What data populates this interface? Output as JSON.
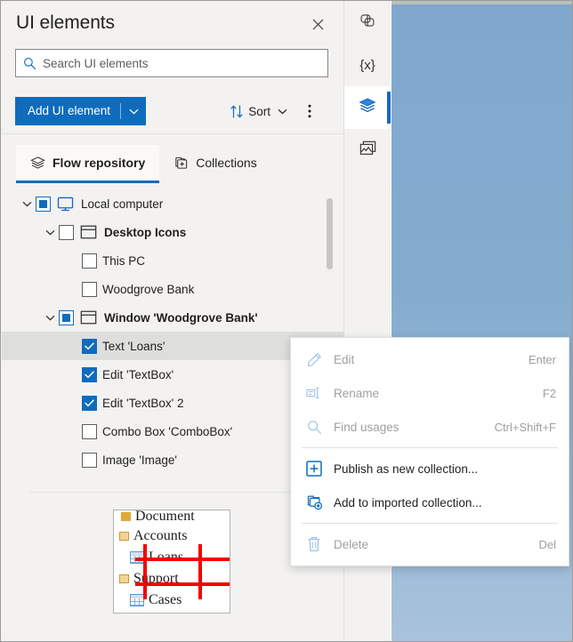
{
  "panel": {
    "title": "UI elements",
    "close_icon": "close-icon"
  },
  "search": {
    "placeholder": "Search UI elements",
    "value": "",
    "icon": "search-icon"
  },
  "toolbar": {
    "add_label": "Add UI element",
    "add_caret_icon": "chevron-down-icon",
    "sort_label": "Sort",
    "sort_icon": "sort-arrows-icon",
    "sort_caret_icon": "chevron-down-icon",
    "more_icon": "more-vertical-icon"
  },
  "tabs": [
    {
      "label": "Flow repository",
      "icon": "layers-icon",
      "active": true
    },
    {
      "label": "Collections",
      "icon": "collection-add-icon",
      "active": false
    }
  ],
  "tree": [
    {
      "label": "Local computer",
      "indent": 0,
      "chevron": "expanded",
      "checkbox": "partial",
      "icon": "monitor-icon",
      "bold": false,
      "selected": false
    },
    {
      "label": "Desktop Icons",
      "indent": 1,
      "chevron": "expanded",
      "checkbox": "unchecked",
      "icon": "window-icon",
      "bold": true,
      "selected": false
    },
    {
      "label": "This PC",
      "indent": 2,
      "chevron": "none",
      "checkbox": "unchecked",
      "icon": "none",
      "bold": false,
      "selected": false
    },
    {
      "label": "Woodgrove Bank",
      "indent": 2,
      "chevron": "none",
      "checkbox": "unchecked",
      "icon": "none",
      "bold": false,
      "selected": false
    },
    {
      "label": "Window 'Woodgrove Bank'",
      "indent": 1,
      "chevron": "expanded",
      "checkbox": "partial",
      "icon": "window-icon",
      "bold": true,
      "selected": false
    },
    {
      "label": "Text 'Loans'",
      "indent": 2,
      "chevron": "none",
      "checkbox": "checked",
      "icon": "none",
      "bold": false,
      "selected": true
    },
    {
      "label": "Edit 'TextBox'",
      "indent": 2,
      "chevron": "none",
      "checkbox": "checked",
      "icon": "none",
      "bold": false,
      "selected": false
    },
    {
      "label": "Edit 'TextBox' 2",
      "indent": 2,
      "chevron": "none",
      "checkbox": "checked",
      "icon": "none",
      "bold": false,
      "selected": false
    },
    {
      "label": "Combo Box 'ComboBox'",
      "indent": 2,
      "chevron": "none",
      "checkbox": "unchecked",
      "icon": "none",
      "bold": false,
      "selected": false
    },
    {
      "label": "Image 'Image'",
      "indent": 2,
      "chevron": "none",
      "checkbox": "unchecked",
      "icon": "none",
      "bold": false,
      "selected": false
    }
  ],
  "preview": {
    "items": [
      {
        "label": "Document",
        "icon": "folder-icon"
      },
      {
        "label": "Accounts",
        "icon": "document-icon"
      },
      {
        "label": "Loans",
        "icon": "table-icon"
      },
      {
        "label": "Support",
        "icon": "document-icon"
      },
      {
        "label": "Cases",
        "icon": "table-icon"
      }
    ],
    "highlight_color": "#f40000",
    "highlighted_label": "Loans"
  },
  "rail": [
    {
      "icon": "flow-icon",
      "active": false
    },
    {
      "icon": "variables-icon",
      "active": false,
      "glyph": "{x}"
    },
    {
      "icon": "ui-elements-icon",
      "active": true
    },
    {
      "icon": "images-icon",
      "active": false
    }
  ],
  "context_menu": [
    {
      "label": "Edit",
      "shortcut": "Enter",
      "icon": "pencil-icon",
      "disabled": true,
      "sep_after": false
    },
    {
      "label": "Rename",
      "shortcut": "F2",
      "icon": "rename-icon",
      "disabled": true,
      "sep_after": false
    },
    {
      "label": "Find usages",
      "shortcut": "Ctrl+Shift+F",
      "icon": "search-icon",
      "disabled": true,
      "sep_after": true
    },
    {
      "label": "Publish as new collection...",
      "shortcut": "",
      "icon": "plus-box-icon",
      "disabled": false,
      "sep_after": false
    },
    {
      "label": "Add to imported collection...",
      "shortcut": "",
      "icon": "collection-add-icon",
      "disabled": false,
      "sep_after": true
    },
    {
      "label": "Delete",
      "shortcut": "Del",
      "icon": "trash-icon",
      "disabled": true,
      "sep_after": false
    }
  ],
  "colors": {
    "accent": "#0f6cbd",
    "panel_bg": "#f3f2f1",
    "selected_row": "#dededd",
    "desktop_blue": "#84accf",
    "highlight_red": "#f40000"
  }
}
